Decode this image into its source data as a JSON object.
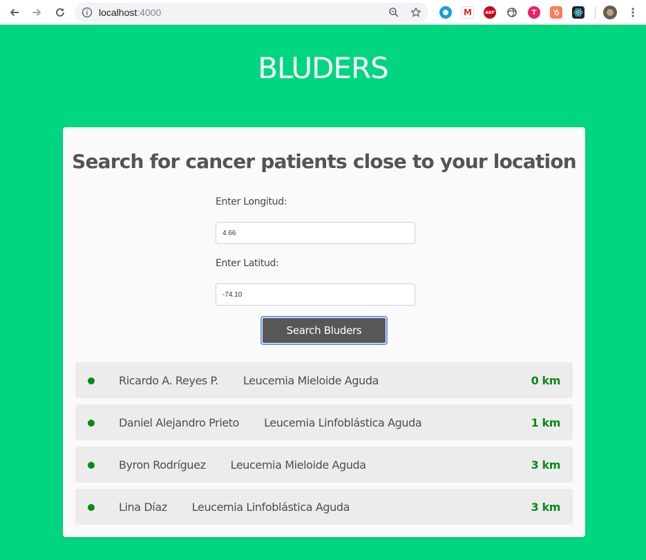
{
  "browser": {
    "url_host": "localhost",
    "url_port": ":4000",
    "icons": [
      "back-icon",
      "forward-icon",
      "reload-icon",
      "info-icon",
      "zoom-icon",
      "star-icon"
    ],
    "extensions": [
      {
        "name": "cyan-circle-extension-icon",
        "label": "",
        "color": "#1a9cde"
      },
      {
        "name": "gmail-extension-icon",
        "label": "M",
        "color": "#d93025"
      },
      {
        "name": "adblock-plus-extension-icon",
        "label": "ABP",
        "color": "#d0021b"
      },
      {
        "name": "swirl-extension-icon",
        "label": "",
        "color": "#555555"
      },
      {
        "name": "pink-extension-icon",
        "label": "T",
        "color": "#ee1e63"
      },
      {
        "name": "hubspot-extension-icon",
        "label": "",
        "color": "#ff7a59"
      },
      {
        "name": "react-devtools-extension-icon",
        "label": "",
        "color": "#222222"
      },
      {
        "name": "profile-avatar-icon",
        "label": "",
        "color": "#6b5b4b"
      }
    ]
  },
  "app": {
    "brand": "BLUDERS"
  },
  "search": {
    "title": "Search for cancer patients close to your location",
    "longitude_label": "Enter Longitud:",
    "longitude_value": "4.66",
    "latitude_label": "Enter Latitud:",
    "latitude_value": "-74.10",
    "button_label": "Search Bluders"
  },
  "results": [
    {
      "name": "Ricardo A. Reyes P.",
      "diagnosis": "Leucemia Mieloide Aguda",
      "distance": "0 km"
    },
    {
      "name": "Daniel Alejandro Prieto",
      "diagnosis": "Leucemia Linfoblástica Aguda",
      "distance": "1 km"
    },
    {
      "name": "Byron Rodríguez",
      "diagnosis": "Leucemia Mieloide Aguda",
      "distance": "3 km"
    },
    {
      "name": "Lina Díaz",
      "diagnosis": "Leucemia Linfoblástica Aguda",
      "distance": "3 km"
    }
  ],
  "colors": {
    "background": "#00d67f",
    "accent_green": "#0a8a15",
    "button": "#575757"
  }
}
